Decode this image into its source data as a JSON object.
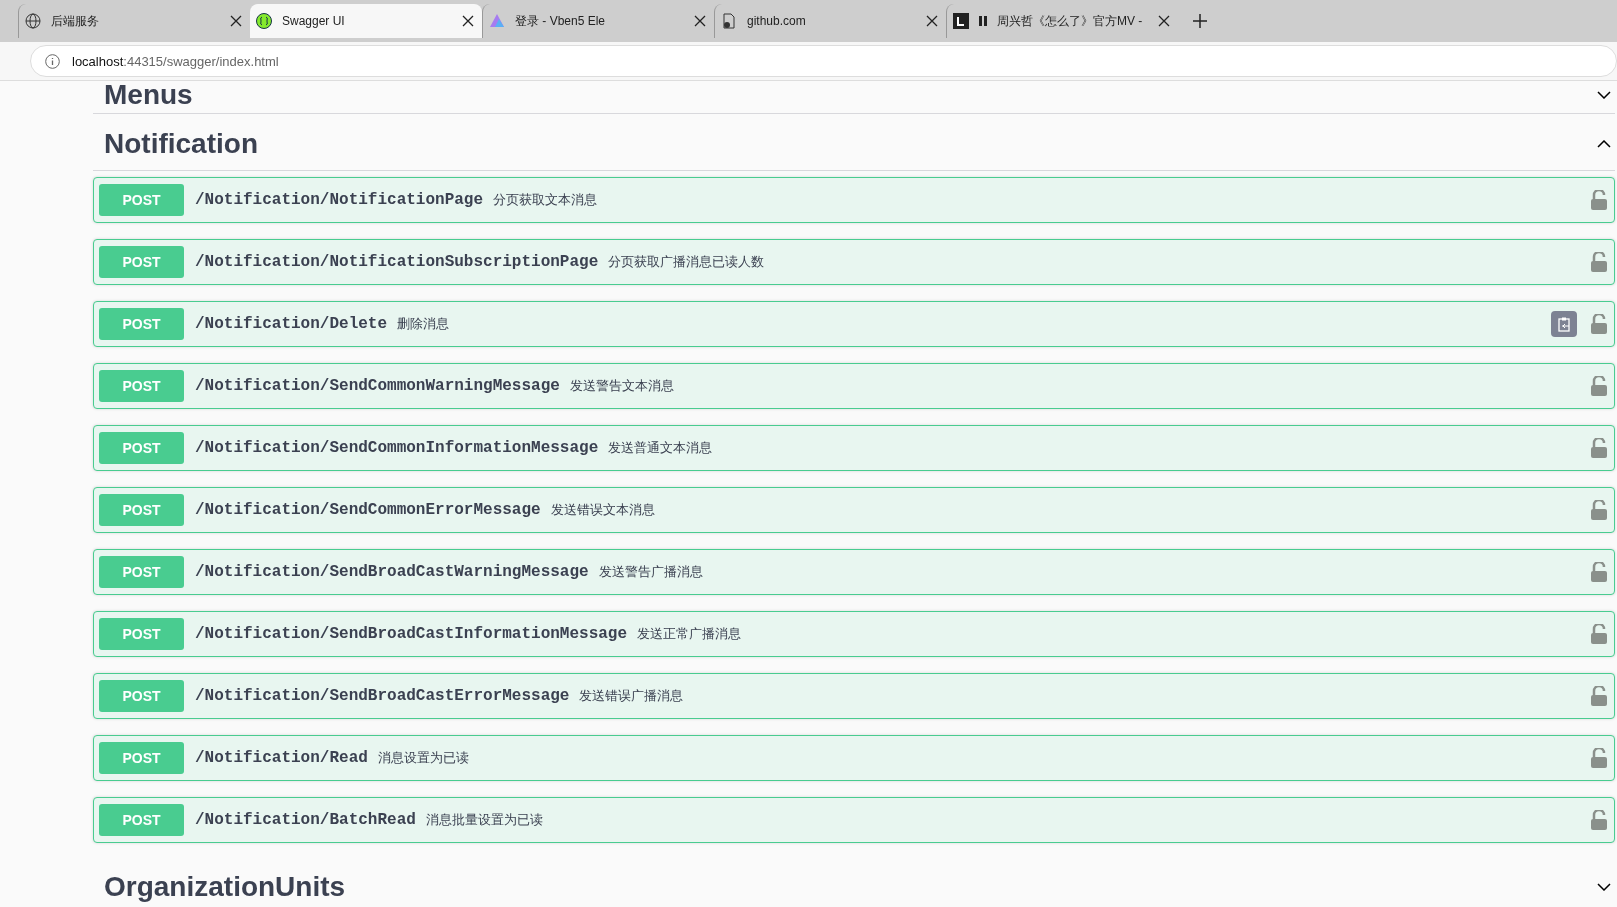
{
  "browser": {
    "tabs": [
      {
        "title": "后端服务",
        "selected": false
      },
      {
        "title": "Swagger UI",
        "selected": true
      },
      {
        "title": "登录 - Vben5 Ele",
        "selected": false
      },
      {
        "title": "github.com",
        "selected": false
      },
      {
        "title": "周兴哲《怎么了》官方MV -",
        "selected": false,
        "paused": true
      }
    ],
    "address": {
      "host": "localhost",
      "rest": ":44315/swagger/index.html"
    }
  },
  "sections": [
    {
      "name": "Menus",
      "expanded": false
    },
    {
      "name": "Notification",
      "expanded": true,
      "operations": [
        {
          "method": "POST",
          "path": "/Notification/NotificationPage",
          "summary": "分页获取文本消息",
          "show_copy": false
        },
        {
          "method": "POST",
          "path": "/Notification/NotificationSubscriptionPage",
          "summary": "分页获取广播消息已读人数",
          "show_copy": false
        },
        {
          "method": "POST",
          "path": "/Notification/Delete",
          "summary": "删除消息",
          "show_copy": true
        },
        {
          "method": "POST",
          "path": "/Notification/SendCommonWarningMessage",
          "summary": "发送警告文本消息",
          "show_copy": false
        },
        {
          "method": "POST",
          "path": "/Notification/SendCommonInformationMessage",
          "summary": "发送普通文本消息",
          "show_copy": false
        },
        {
          "method": "POST",
          "path": "/Notification/SendCommonErrorMessage",
          "summary": "发送错误文本消息",
          "show_copy": false
        },
        {
          "method": "POST",
          "path": "/Notification/SendBroadCastWarningMessage",
          "summary": "发送警告广播消息",
          "show_copy": false
        },
        {
          "method": "POST",
          "path": "/Notification/SendBroadCastInformationMessage",
          "summary": "发送正常广播消息",
          "show_copy": false
        },
        {
          "method": "POST",
          "path": "/Notification/SendBroadCastErrorMessage",
          "summary": "发送错误广播消息",
          "show_copy": false
        },
        {
          "method": "POST",
          "path": "/Notification/Read",
          "summary": "消息设置为已读",
          "show_copy": false
        },
        {
          "method": "POST",
          "path": "/Notification/BatchRead",
          "summary": "消息批量设置为已读",
          "show_copy": false
        }
      ]
    },
    {
      "name": "OrganizationUnits",
      "expanded": false
    }
  ]
}
